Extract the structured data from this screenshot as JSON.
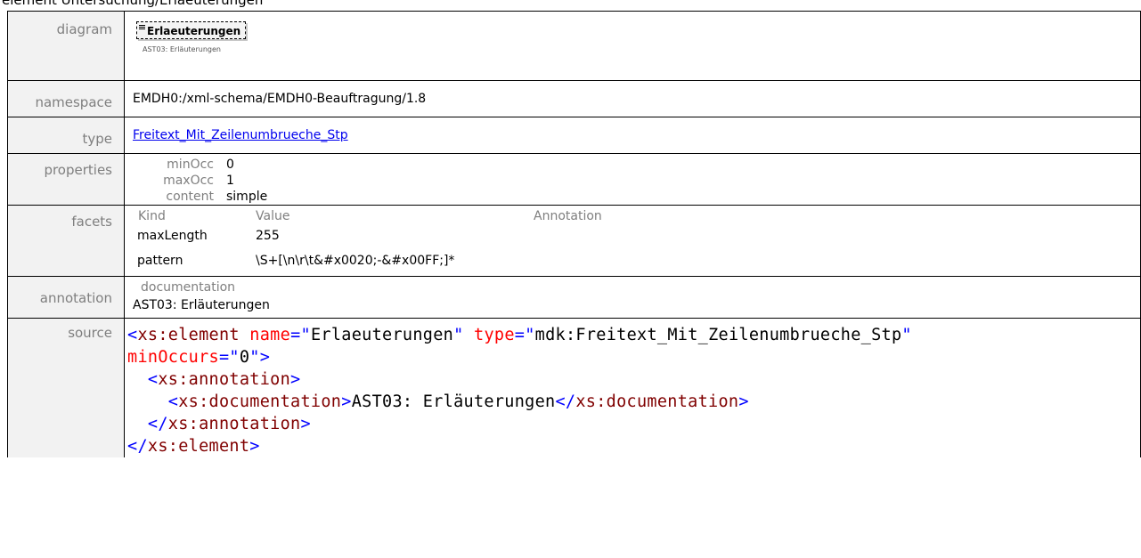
{
  "heading": "element Untersuchung/Erlaeuterungen",
  "rows": {
    "diagram": {
      "label": "diagram",
      "box_label": "Erlaeuterungen",
      "caption": "AST03: Erläuterungen"
    },
    "namespace": {
      "label": "namespace",
      "value": "EMDH0:/xml-schema/EMDH0-Beauftragung/1.8"
    },
    "type": {
      "label": "type",
      "value": "Freitext_Mit_Zeilenumbrueche_Stp"
    },
    "properties": {
      "label": "properties",
      "items": [
        {
          "key": "minOcc",
          "value": "0"
        },
        {
          "key": "maxOcc",
          "value": "1"
        },
        {
          "key": "content",
          "value": "simple"
        }
      ]
    },
    "facets": {
      "label": "facets",
      "headers": {
        "kind": "Kind",
        "value": "Value",
        "annotation": "Annotation"
      },
      "items": [
        {
          "kind": "maxLength",
          "value": "255"
        },
        {
          "kind": "pattern",
          "value": "\\S+[\\n\\r\\t&#x0020;-&#x00FF;]*"
        }
      ]
    },
    "annotation": {
      "label": "annotation",
      "sub_label": "documentation",
      "value": "AST03: Erläuterungen"
    },
    "source": {
      "label": "source",
      "line1": {
        "open": "<",
        "tag": "xs:element",
        "attr1": "name",
        "eq1": "=\"",
        "val1": "Erlaeuterungen",
        "q1": "\"",
        "attr2": "type",
        "eq2": "=\"",
        "val2": "mdk:Freitext_Mit_Zeilenumbrueche_Stp",
        "q2": "\""
      },
      "line2": {
        "attr": "minOccurs",
        "eq": "=\"",
        "val": "0",
        "close": "\">"
      },
      "line3": {
        "open": "<",
        "tag": "xs:annotation",
        "close": ">"
      },
      "line4": {
        "open": "<",
        "tag": "xs:documentation",
        "close": ">",
        "text": "AST03: Erläuterungen",
        "open2": "</",
        "tag2": "xs:documentation",
        "close2": ">"
      },
      "line5": {
        "open": "</",
        "tag": "xs:annotation",
        "close": ">"
      },
      "line6": {
        "open": "</",
        "tag": "xs:element",
        "close": ">"
      }
    }
  },
  "colors": {
    "label_bg": "#f2f2f2",
    "tag": "#800000",
    "attribute": "#ff0000",
    "symbol": "#0000ff",
    "link": "#0000ee"
  }
}
